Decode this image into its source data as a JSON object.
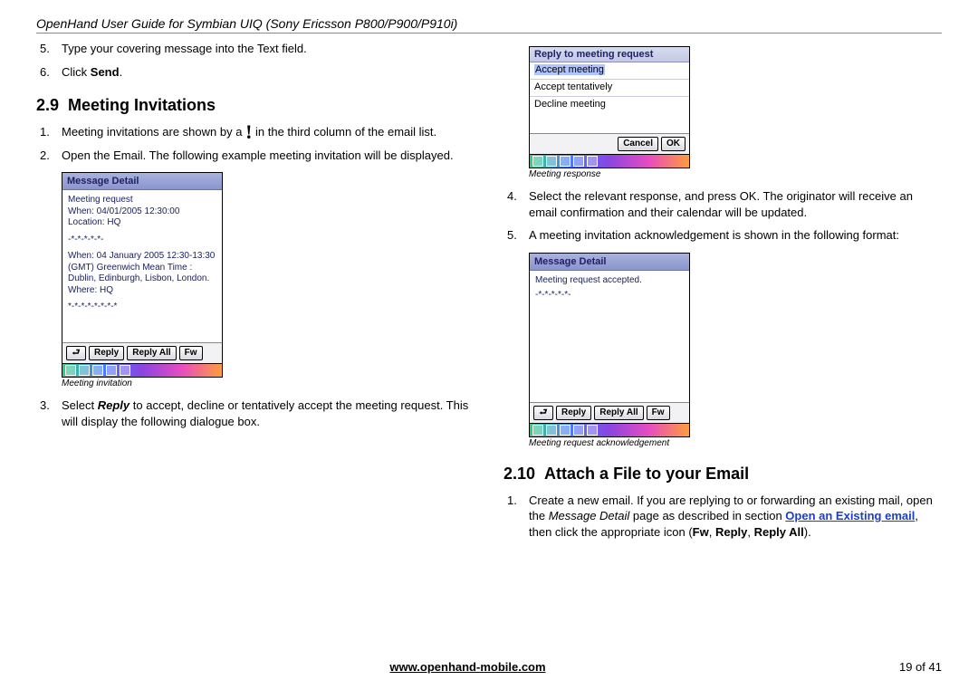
{
  "header": "OpenHand User Guide for Symbian UIQ (Sony Ericsson P800/P900/P910i)",
  "left": {
    "items_pre": [
      {
        "n": "5.",
        "text": "Type your covering message into the Text field."
      },
      {
        "n": "6.",
        "pre": "Click ",
        "b": "Send",
        "post": "."
      }
    ],
    "section_num": "2.9",
    "section_title": "Meeting Invitations",
    "item1": {
      "n": "1.",
      "pre": "Meeting invitations are shown by a ",
      "post": " in the third column of the email list."
    },
    "item2": {
      "n": "2.",
      "text": "Open the Email.  The following example meeting invitation will be displayed."
    },
    "fig1_title": "Message Detail",
    "fig1_body1": "Meeting request",
    "fig1_body2": "When: 04/01/2005 12:30:00",
    "fig1_body3": "Location: HQ",
    "fig1_sep": "-*-*-*-*-*-",
    "fig1_body4": "When: 04 January 2005 12:30-13:30",
    "fig1_body5": "(GMT) Greenwich Mean Time :",
    "fig1_body6": "Dublin, Edinburgh, Lisbon, London.",
    "fig1_body7": "Where: HQ",
    "fig1_sep2": "*-*-*-*-*-*-*-*",
    "btn_back": "⮐",
    "btn_reply": "Reply",
    "btn_replyall": "Reply All",
    "btn_fw": "Fw",
    "fig1_caption": "Meeting invitation",
    "item3": {
      "n": "3.",
      "pre": "Select ",
      "b": "Reply",
      "post": " to accept, decline or tentatively accept the meeting request.  This will display the following dialogue box."
    }
  },
  "right": {
    "fig2_title": "Reply to meeting request",
    "fig2_opts": [
      "Accept meeting",
      "Accept tentatively",
      "Decline meeting"
    ],
    "btn_cancel": "Cancel",
    "btn_ok": "OK",
    "fig2_caption": "Meeting response",
    "item4": {
      "n": "4.",
      "text": "Select the relevant response, and press OK.  The originator will receive an email confirmation and their calendar will be updated."
    },
    "item5": {
      "n": "5.",
      "text": "A meeting invitation acknowledgement is shown in the following format:"
    },
    "fig3_title": "Message Detail",
    "fig3_body1": "Meeting request accepted.",
    "fig3_body2": "-*-*-*-*-*-",
    "fig3_caption": "Meeting request acknowledgement",
    "section_num": "2.10",
    "section_title": "Attach a File to your Email",
    "item_a1": {
      "n": "1.",
      "t1": "Create a new email. If you are replying to or forwarding an existing mail, open the ",
      "i1": "Message Detail",
      "t2": " page as described in section ",
      "link": "Open an Existing email",
      "t3": ", then click the appropriate icon (",
      "b1": "Fw",
      "c1": ", ",
      "b2": "Reply",
      "c2": ", ",
      "b3": "Reply All",
      "t4": ")."
    }
  },
  "footer": {
    "site": "www.openhand-mobile.com",
    "page": "19 of 41"
  }
}
